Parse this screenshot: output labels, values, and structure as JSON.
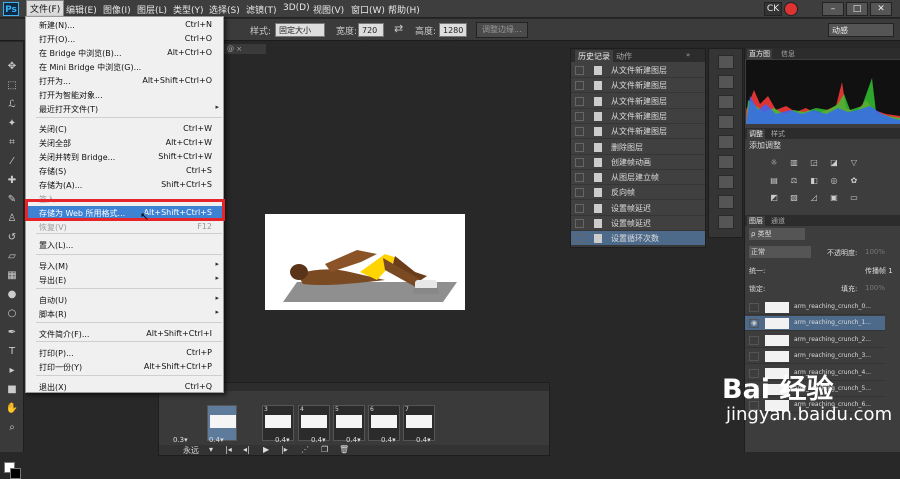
{
  "app": {
    "logo": "Ps"
  },
  "menubar": [
    {
      "label": "文件(F)",
      "active": true
    },
    {
      "label": "编辑(E)"
    },
    {
      "label": "图像(I)"
    },
    {
      "label": "图层(L)"
    },
    {
      "label": "类型(Y)"
    },
    {
      "label": "选择(S)"
    },
    {
      "label": "滤镜(T)"
    },
    {
      "label": "3D(D)"
    },
    {
      "label": "视图(V)"
    },
    {
      "label": "窗口(W)"
    },
    {
      "label": "帮助(H)"
    }
  ],
  "window_controls": {
    "ck": "CK",
    "minimize": "–",
    "maximize": "□",
    "close": "✕"
  },
  "options": {
    "style_label": "样式:",
    "style_value": "固定大小",
    "width_label": "宽度:",
    "width_value": "720 像",
    "height_label": "高度:",
    "height_value": "1280 像",
    "refine_button": "调整边缘...",
    "workspace": "动感"
  },
  "file_menu": [
    {
      "label": "新建(N)...",
      "shortcut": "Ctrl+N"
    },
    {
      "label": "打开(O)...",
      "shortcut": "Ctrl+O"
    },
    {
      "label": "在 Bridge 中浏览(B)...",
      "shortcut": "Alt+Ctrl+O"
    },
    {
      "label": "在 Mini Bridge 中浏览(G)...",
      "shortcut": ""
    },
    {
      "label": "打开为...",
      "shortcut": "Alt+Shift+Ctrl+O"
    },
    {
      "label": "打开为智能对象...",
      "shortcut": ""
    },
    {
      "label": "最近打开文件(T)",
      "shortcut": "",
      "submenu": true
    },
    {
      "label": "关闭(C)",
      "shortcut": "Ctrl+W"
    },
    {
      "label": "关闭全部",
      "shortcut": "Alt+Ctrl+W"
    },
    {
      "label": "关闭并转到 Bridge...",
      "shortcut": "Shift+Ctrl+W"
    },
    {
      "label": "存储(S)",
      "shortcut": "Ctrl+S"
    },
    {
      "label": "存储为(A)...",
      "shortcut": "Shift+Ctrl+S"
    },
    {
      "label": "签入...",
      "shortcut": "",
      "disabled": true
    },
    {
      "label": "存储为 Web 所用格式...",
      "shortcut": "Alt+Shift+Ctrl+S",
      "highlighted": true
    },
    {
      "label": "恢复(V)",
      "shortcut": "F12",
      "disabled": true
    },
    {
      "label": "置入(L)...",
      "shortcut": ""
    },
    {
      "label": "导入(M)",
      "shortcut": "",
      "submenu": true
    },
    {
      "label": "导出(E)",
      "shortcut": "",
      "submenu": true
    },
    {
      "label": "自动(U)",
      "shortcut": "",
      "submenu": true
    },
    {
      "label": "脚本(R)",
      "shortcut": "",
      "submenu": true
    },
    {
      "label": "文件简介(F)...",
      "shortcut": "Alt+Shift+Ctrl+I"
    },
    {
      "label": "打印(P)...",
      "shortcut": "Ctrl+P"
    },
    {
      "label": "打印一份(Y)",
      "shortcut": "Alt+Shift+Ctrl+P"
    },
    {
      "label": "退出(X)",
      "shortcut": "Ctrl+Q"
    }
  ],
  "history": {
    "tabs": [
      "历史记录",
      "动作"
    ],
    "items": [
      "从文件新建图层",
      "从文件新建图层",
      "从文件新建图层",
      "从文件新建图层",
      "从文件新建图层",
      "删除图层",
      "创建帧动画",
      "从图层建立帧",
      "反向帧",
      "设置帧延迟",
      "设置帧延迟",
      "设置循环次数"
    ]
  },
  "right_panel": {
    "histogram_tabs": [
      "直方图",
      "信息"
    ],
    "adjust_tabs": [
      "调整",
      "样式"
    ],
    "adjust_title": "添加调整",
    "layer_tabs": [
      "图层",
      "通道"
    ],
    "layer_kind": "ρ 类型",
    "blend_mode": "正常",
    "opacity_label": "不透明度:",
    "opacity_value": "100%",
    "unify_label": "统一:",
    "propagate_label": "传播帧 1",
    "lock_label": "锁定:",
    "fill_label": "填充:",
    "fill_value": "100%",
    "layers": [
      "arm_reaching_crunch_0...",
      "arm_reaching_crunch_1...",
      "arm_reaching_crunch_2...",
      "arm_reaching_crunch_3...",
      "arm_reaching_crunch_4...",
      "arm_reaching_crunch_5...",
      "arm_reaching_crunch_6..."
    ]
  },
  "timeline": {
    "frames": [
      {
        "num": "3",
        "dur": "0.4▾"
      },
      {
        "num": "4",
        "dur": "0.4▾"
      },
      {
        "num": "5",
        "dur": "0.4▾"
      },
      {
        "num": "6",
        "dur": "0.4▾"
      },
      {
        "num": "7",
        "dur": "0.4▾"
      }
    ],
    "first_dur": "0.3▾",
    "sel_dur": "0.4▾",
    "loop": "永远"
  },
  "watermark": {
    "logo": "Bai 经验",
    "url": "jingyan.baidu.com"
  }
}
